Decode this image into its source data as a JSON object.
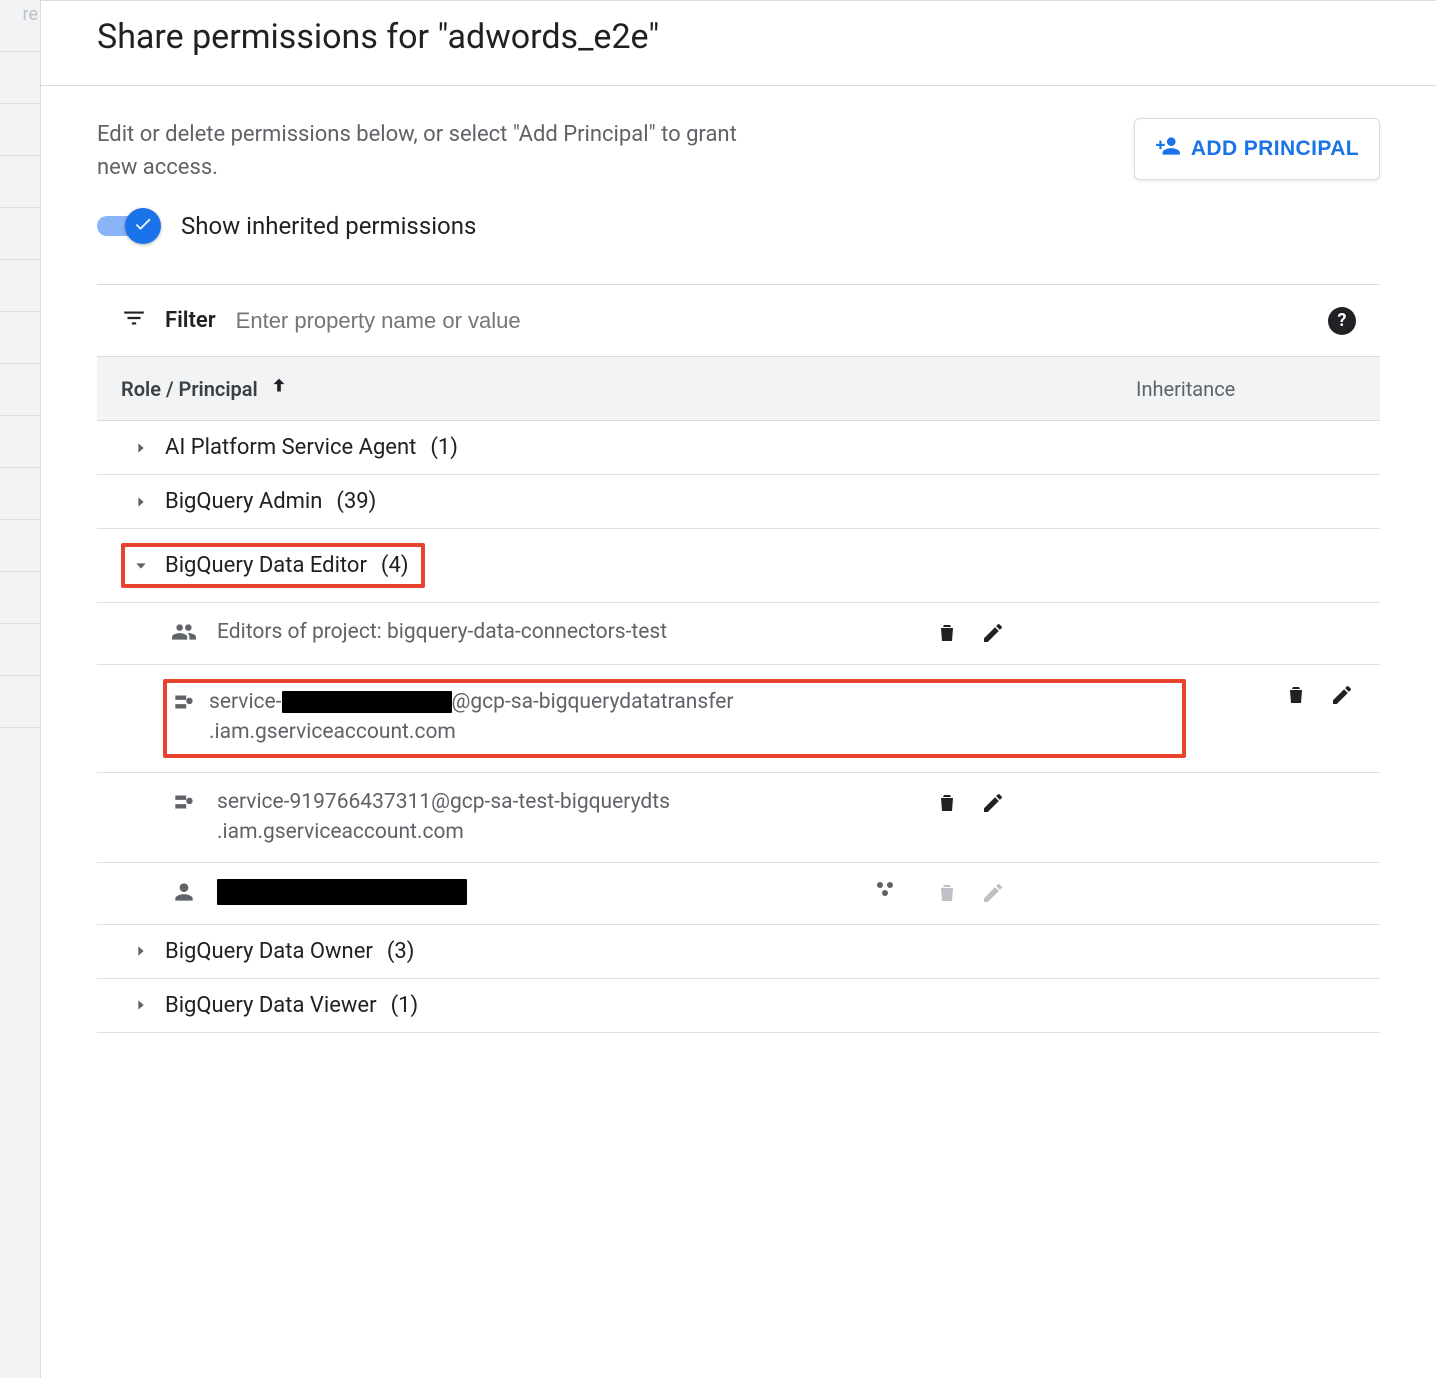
{
  "header": {
    "title": "Share permissions for \"adwords_e2e\""
  },
  "subhead": {
    "description": "Edit or delete permissions below, or select \"Add Principal\" to grant new access.",
    "add_principal_label": "ADD PRINCIPAL"
  },
  "toggle": {
    "label": "Show inherited permissions",
    "on": true
  },
  "filter": {
    "label": "Filter",
    "placeholder": "Enter property name or value"
  },
  "columns": {
    "role_principal": "Role / Principal",
    "inheritance": "Inheritance"
  },
  "roles": [
    {
      "name": "AI Platform Service Agent",
      "count": 1,
      "expanded": false
    },
    {
      "name": "BigQuery Admin",
      "count": 39,
      "expanded": false
    },
    {
      "name": "BigQuery Data Editor",
      "count": 4,
      "expanded": true,
      "highlight": true
    },
    {
      "name": "BigQuery Data Owner",
      "count": 3,
      "expanded": false
    },
    {
      "name": "BigQuery Data Viewer",
      "count": 1,
      "expanded": false
    }
  ],
  "data_editor_principals": [
    {
      "type": "group",
      "text": "Editors of project: bigquery-data-connectors-test",
      "inherited": false,
      "readonly": false,
      "highlight": false
    },
    {
      "type": "service-account",
      "prefix": "service-",
      "redacted": true,
      "suffix1": "@gcp-sa-bigquerydatatransfer",
      "suffix2": ".iam.gserviceaccount.com",
      "inherited": false,
      "readonly": false,
      "highlight": true
    },
    {
      "type": "service-account",
      "text1": "service-919766437311@gcp-sa-test-bigquerydts",
      "text2": ".iam.gserviceaccount.com",
      "inherited": false,
      "readonly": false,
      "highlight": false
    },
    {
      "type": "user",
      "redacted_full": true,
      "inherited": true,
      "readonly": true,
      "highlight": false
    }
  ],
  "left_edge_fragment": "re"
}
